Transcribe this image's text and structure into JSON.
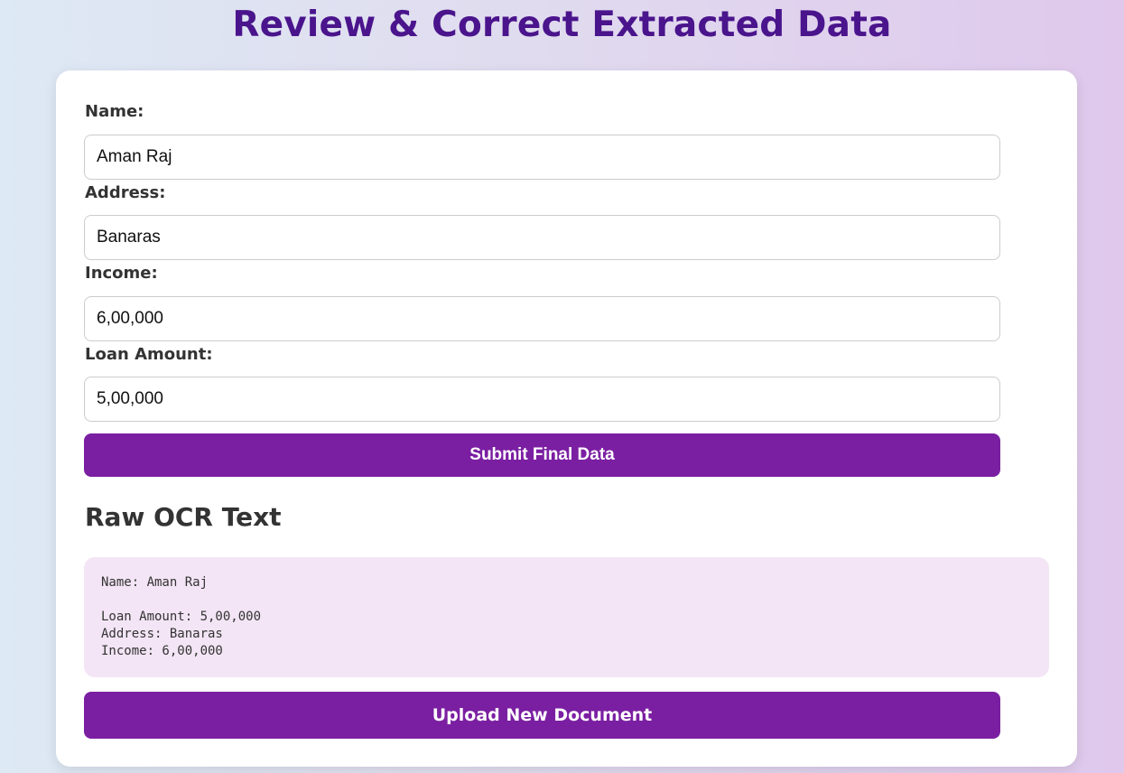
{
  "header": {
    "title": "Review & Correct Extracted Data"
  },
  "form": {
    "name": {
      "label": "Name:",
      "value": "Aman Raj"
    },
    "address": {
      "label": "Address:",
      "value": "Banaras"
    },
    "income": {
      "label": "Income:",
      "value": "6,00,000"
    },
    "loan_amount": {
      "label": "Loan Amount:",
      "value": "5,00,000"
    },
    "submit_label": "Submit Final Data"
  },
  "ocr": {
    "heading": "Raw OCR Text",
    "text": "Name: Aman Raj\n\nLoan Amount: 5,00,000\nAddress: Banaras\nIncome: 6,00,000"
  },
  "actions": {
    "upload_label": "Upload New Document"
  },
  "colors": {
    "accent": "#7b1fa2",
    "title": "#4a148c",
    "ocr_background": "#f3e5f5"
  }
}
